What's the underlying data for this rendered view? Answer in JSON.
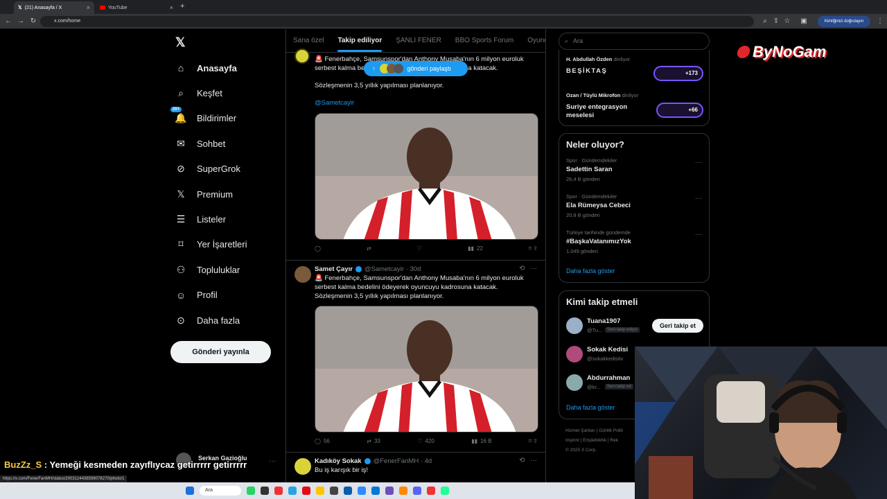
{
  "browser": {
    "tabs": [
      {
        "label": "(21) Anasayfa / X"
      },
      {
        "label": "YouTube"
      }
    ],
    "url": "x.com/home",
    "signin_label": "Kimliğinizi doğrulayın",
    "status_url": "https://x.com/FenerFanMH/status/2003124438599078270/photo/1"
  },
  "nav": {
    "items": [
      {
        "label": "Anasayfa",
        "icon": "home-icon"
      },
      {
        "label": "Keşfet",
        "icon": "search-icon"
      },
      {
        "label": "Bildirimler",
        "icon": "bell-icon",
        "badge": "20+"
      },
      {
        "label": "Sohbet",
        "icon": "mail-icon"
      },
      {
        "label": "SuperGrok",
        "icon": "grok-icon"
      },
      {
        "label": "Premium",
        "icon": "x-logo-icon"
      },
      {
        "label": "Listeler",
        "icon": "list-icon"
      },
      {
        "label": "Yer İşaretleri",
        "icon": "bookmark-icon"
      },
      {
        "label": "Topluluklar",
        "icon": "communities-icon"
      },
      {
        "label": "Profil",
        "icon": "profile-icon"
      },
      {
        "label": "Daha fazla",
        "icon": "more-circle-icon"
      }
    ],
    "post_button": "Gönderi yayınla",
    "account_name": "Serkan Gazioğlu"
  },
  "feed": {
    "tabs": [
      "Sana özel",
      "Takip ediliyor",
      "ŞANLI FENER",
      "BBO Sports Forum",
      "Oyuncu T"
    ],
    "selected_tab": "Takip ediliyor",
    "new_posts_pill": "gönderi paylaştı",
    "tweet1": {
      "line1": "🚨 Fenerbahçe, Samsunspor'dan Anthony Musaba'nın 6 milyon euroluk",
      "line2": "serbest kalma bedelini ödeyerek oyuncuyu kadrosuna katacak.",
      "line3": "Sözleşmenin 3,5 yıllık yapılması planlanıyor.",
      "mention": "@Sametcayir",
      "views": "22"
    },
    "tweet2": {
      "name": "Samet Çayır",
      "handle": "@Sametcayir · 30d",
      "line1": "🚨 Fenerbahçe, Samsunspor'dan Anthony Musaba'nın 6 milyon euroluk",
      "line2": "serbest kalma bedelini ödeyerek oyuncuyu kadrosuna katacak.",
      "line3": "Sözleşmenin 3,5 yıllık yapılması planlanıyor.",
      "replies": "56",
      "retweets": "33",
      "likes": "420",
      "views": "16 B"
    },
    "tweet3": {
      "name": "Kadıköy Sokak",
      "handle": "@FenerFanMH · 4d",
      "text": "Bu iş karışık bir iş!"
    }
  },
  "right": {
    "search_placeholder": "Ara",
    "spaces": [
      {
        "host": "H. Abdullah Özden",
        "status": "dinliyor",
        "title": "BEŞİKTAŞ",
        "count": "+173"
      },
      {
        "host": "Ozan / Tüylü Mikrofon",
        "status": "dinliyor",
        "title": "Suriye entegrasyon meselesi",
        "count": "+66"
      }
    ],
    "trends_title": "Neler oluyor?",
    "trends": [
      {
        "context": "Spor · Gündemdekiler",
        "name": "Sadettin Saran",
        "count": "26,4 B gönderi"
      },
      {
        "context": "Spor · Gündemdekiler",
        "name": "Ela Rümeysa Cebeci",
        "count": "20,9 B gönderi"
      },
      {
        "context": "Türkiye tarihinde gündemde",
        "name": "#BaşkaVatanımızYok",
        "count": "1.049 gönderi"
      }
    ],
    "show_more": "Daha fazla göster",
    "who_title": "Kimi takip etmeli",
    "who": [
      {
        "name": "Tuana1907",
        "handle": "@Tu...",
        "tag": "Seni takip ediyor",
        "button": "Geri takip et"
      },
      {
        "name": "Sokak Kedisi",
        "handle": "@sokakkedisitv"
      },
      {
        "name": "Abdurrahman",
        "handle": "@kr...",
        "tag": "Seni takip ed"
      }
    ],
    "who_more": "Daha fazla göster",
    "footer1": "Hizmet Şartları  |  Gizlilik Politi",
    "footer2": "Imprint  |  Erişilebilirlik  |  Rek",
    "footer3": "© 2025 X Corp."
  },
  "overlay": {
    "brand": "ByNoGam",
    "chat_user": "BuzZz_S",
    "chat_text": "Yemeği kesmeden zayıflıycaz getirrrrr getirrrrr",
    "taskbar_search": "Ara"
  },
  "colors": {
    "accent": "#1d9bf0",
    "bg": "#000000",
    "text": "#e7e9ea",
    "muted": "#71767b",
    "border": "#2f3336"
  }
}
